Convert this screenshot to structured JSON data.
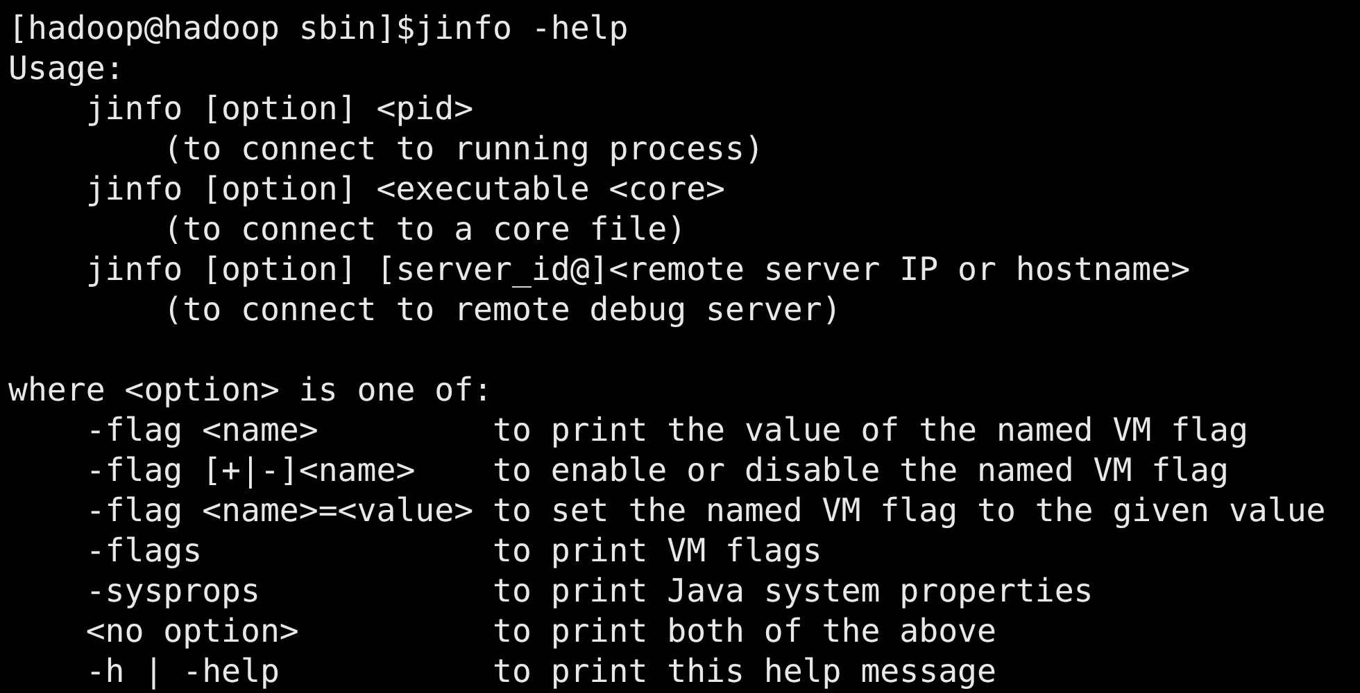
{
  "prompt": {
    "user_host": "[hadoop@hadoop sbin]$",
    "command": "jinfo -help"
  },
  "usage": {
    "heading": "Usage:",
    "forms": [
      {
        "syntax": "jinfo [option] <pid>",
        "note": "(to connect to running process)"
      },
      {
        "syntax": "jinfo [option] <executable <core>",
        "note": "(to connect to a core file)"
      },
      {
        "syntax": "jinfo [option] [server_id@]<remote server IP or hostname>",
        "note": "(to connect to remote debug server)"
      }
    ]
  },
  "options": {
    "heading": "where <option> is one of:",
    "rows": [
      {
        "option": "-flag <name>",
        "description": "to print the value of the named VM flag"
      },
      {
        "option": "-flag [+|-]<name>",
        "description": "to enable or disable the named VM flag"
      },
      {
        "option": "-flag <name>=<value>",
        "description": "to set the named VM flag to the given value"
      },
      {
        "option": "-flags",
        "description": "to print VM flags"
      },
      {
        "option": "-sysprops",
        "description": "to print Java system properties"
      },
      {
        "option": "<no option>",
        "description": "to print both of the above"
      },
      {
        "option": "-h | -help",
        "description": "to print this help message"
      }
    ]
  }
}
